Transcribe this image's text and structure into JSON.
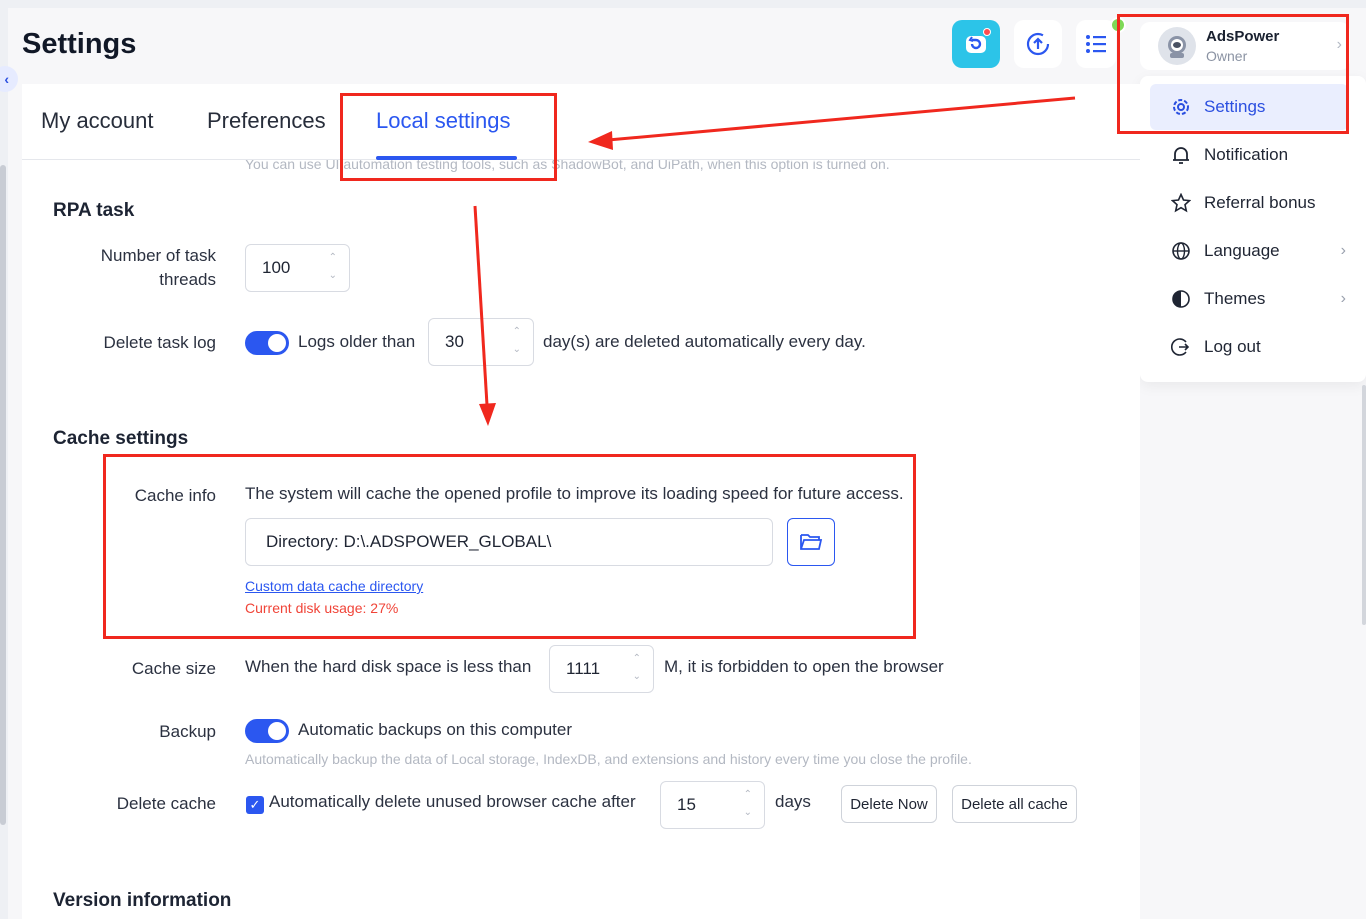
{
  "header": {
    "title": "Settings",
    "user": {
      "name": "AdsPower",
      "role": "Owner"
    }
  },
  "menu": {
    "items": [
      {
        "label": "Settings",
        "icon": "gear-icon"
      },
      {
        "label": "Notification",
        "icon": "bell-icon"
      },
      {
        "label": "Referral bonus",
        "icon": "star-icon"
      },
      {
        "label": "Language",
        "icon": "globe-icon"
      },
      {
        "label": "Themes",
        "icon": "contrast-icon"
      },
      {
        "label": "Log out",
        "icon": "logout-icon"
      }
    ]
  },
  "tabs": [
    {
      "label": "My account"
    },
    {
      "label": "Preferences"
    },
    {
      "label": "Local settings"
    }
  ],
  "content": {
    "cut_text": "You can use UI automation testing tools, such as ShadowBot, and UiPath, when this option is turned on.",
    "rpa": {
      "title": "RPA task",
      "threads_label_1": "Number of task",
      "threads_label_2": "threads",
      "threads_value": "100",
      "delete_log_label": "Delete task log",
      "logs_older_than": "Logs older than",
      "log_days": "30",
      "log_suffix": "day(s) are deleted automatically every day."
    },
    "cache": {
      "title": "Cache settings",
      "info_label": "Cache info",
      "info_text": "The system will cache the opened profile to improve its loading speed for future access.",
      "directory": "Directory: D:\\.ADSPOWER_GLOBAL\\",
      "custom_link": "Custom data cache directory",
      "disk_usage": "Current disk usage: 27%",
      "size_label": "Cache size",
      "size_prefix": "When the hard disk space is less than",
      "size_value": "1111",
      "size_suffix": "M, it is forbidden to open the browser",
      "backup_label": "Backup",
      "backup_text": "Automatic backups on this computer",
      "backup_hint": "Automatically backup the data of Local storage, IndexDB, and extensions and history every time you close the profile.",
      "delete_label": "Delete cache",
      "delete_text": "Automatically delete unused browser cache after",
      "delete_days": "15",
      "days_label": "days",
      "delete_now": "Delete Now",
      "delete_all": "Delete all cache"
    },
    "version_title": "Version information"
  },
  "colors": {
    "accent": "#2b57f0",
    "annotation": "#f0281e",
    "danger": "#f04438"
  }
}
